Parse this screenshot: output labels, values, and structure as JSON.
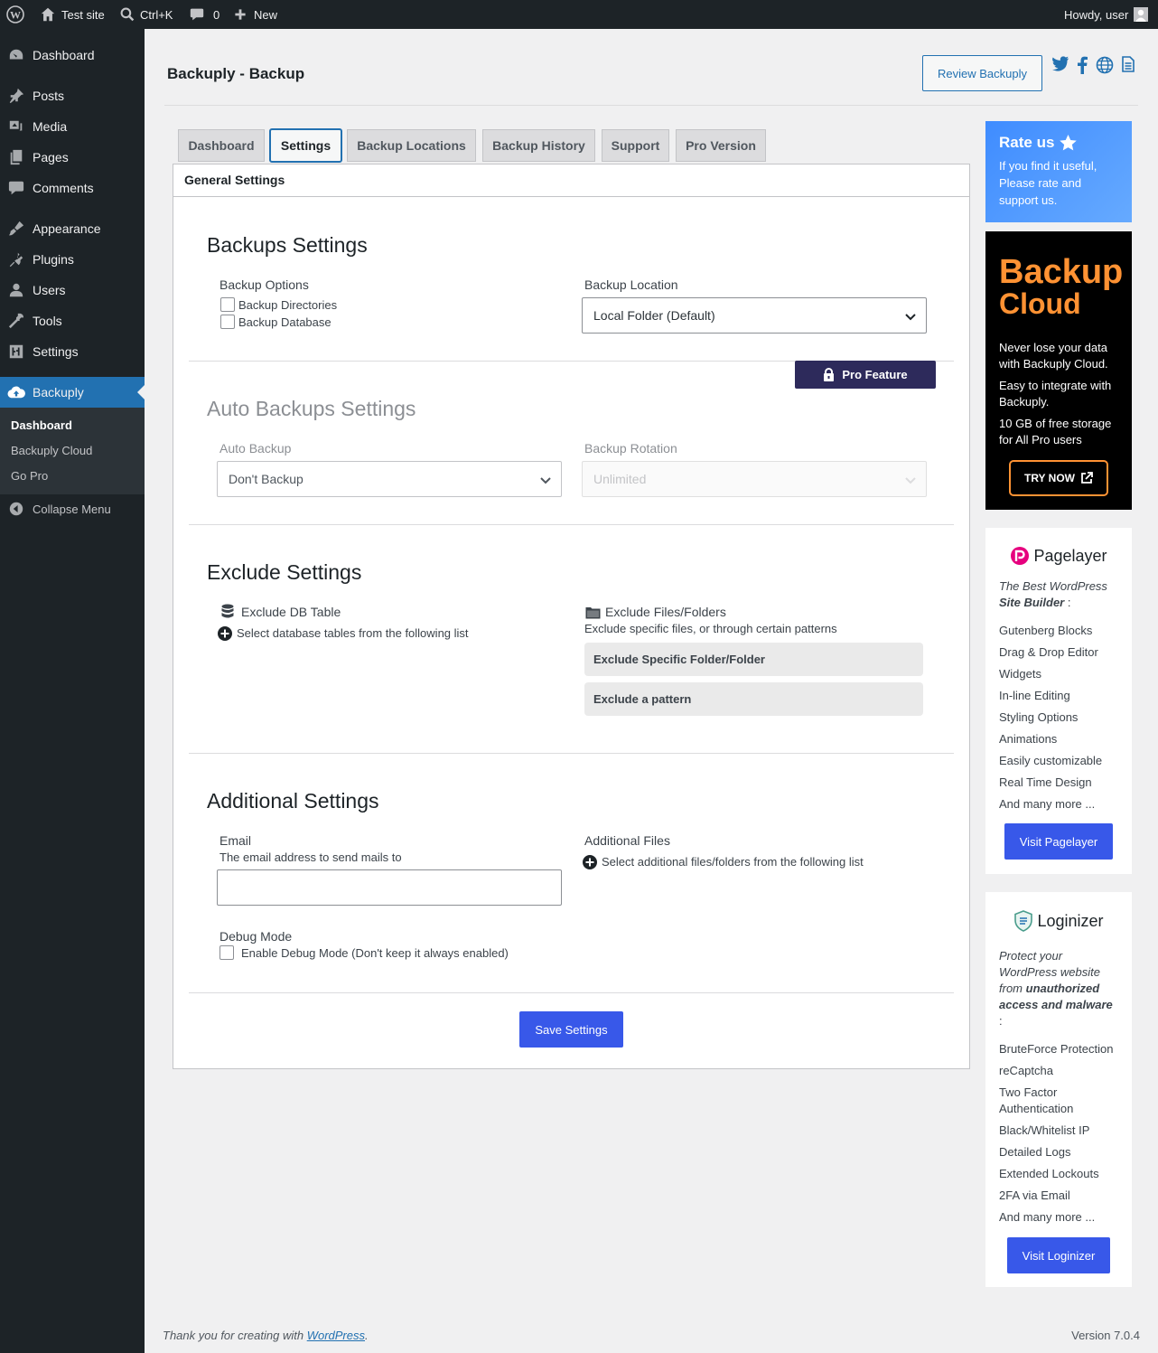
{
  "adminbar": {
    "site_name": "Test site",
    "search_shortcut": "Ctrl+K",
    "comments_count": "0",
    "new_label": "New",
    "howdy": "Howdy, user"
  },
  "sidebar": {
    "items": [
      {
        "label": "Dashboard",
        "icon": "dashboard-icon"
      },
      {
        "label": "Posts",
        "icon": "pin-icon"
      },
      {
        "label": "Media",
        "icon": "media-icon"
      },
      {
        "label": "Pages",
        "icon": "pages-icon"
      },
      {
        "label": "Comments",
        "icon": "comment-icon"
      },
      {
        "label": "Appearance",
        "icon": "brush-icon"
      },
      {
        "label": "Plugins",
        "icon": "plug-icon"
      },
      {
        "label": "Users",
        "icon": "user-icon"
      },
      {
        "label": "Tools",
        "icon": "wrench-icon"
      },
      {
        "label": "Settings",
        "icon": "sliders-icon"
      },
      {
        "label": "Backuply",
        "icon": "cloud-upload-icon"
      }
    ],
    "submenu": [
      "Dashboard",
      "Backuply Cloud",
      "Go Pro"
    ],
    "collapse": "Collapse Menu"
  },
  "header": {
    "title": "Backuply - Backup",
    "review_button": "Review Backuply"
  },
  "tabs": [
    "Dashboard",
    "Settings",
    "Backup Locations",
    "Backup History",
    "Support",
    "Pro Version"
  ],
  "panel": {
    "heading": "General Settings",
    "backups": {
      "title": "Backups Settings",
      "options_label": "Backup Options",
      "opt_dirs": "Backup Directories",
      "opt_db": "Backup Database",
      "location_label": "Backup Location",
      "location_value": "Local Folder (Default)"
    },
    "auto": {
      "pro_badge": "Pro Feature",
      "title": "Auto Backups Settings",
      "auto_label": "Auto Backup",
      "auto_value": "Don't Backup",
      "rotation_label": "Backup Rotation",
      "rotation_value": "Unlimited"
    },
    "exclude": {
      "title": "Exclude Settings",
      "db_label": "Exclude DB Table",
      "db_help": "Select database tables from the following list",
      "files_label": "Exclude Files/Folders",
      "files_help": "Exclude specific files, or through certain patterns",
      "btn_folder": "Exclude Specific Folder/Folder",
      "btn_pattern": "Exclude a pattern"
    },
    "additional": {
      "title": "Additional Settings",
      "email_label": "Email",
      "email_help": "The email address to send mails to",
      "email_value": "",
      "files_label": "Additional Files",
      "files_help": "Select additional files/folders from the following list",
      "debug_label": "Debug Mode",
      "debug_help": "Enable Debug Mode (Don't keep it always enabled)"
    },
    "save": "Save Settings"
  },
  "rate": {
    "title": "Rate us",
    "text": "If you find it useful, Please rate and support us."
  },
  "cloud": {
    "title1": "Backup",
    "title2": "Cloud",
    "text1": "Never lose your data with Backuply Cloud.",
    "text2": "Easy to integrate with Backuply.",
    "text3": "10 GB of free storage for All Pro users",
    "button": "TRY NOW"
  },
  "pagelayer": {
    "name": "Pagelayer",
    "desc_plain": "The Best WordPress",
    "desc_bold": "Site Builder",
    "desc_end": " :",
    "features": [
      "Gutenberg Blocks",
      "Drag & Drop Editor",
      "Widgets",
      "In-line Editing",
      "Styling Options",
      "Animations",
      "Easily customizable",
      "Real Time Design",
      "And many more ..."
    ],
    "button": "Visit Pagelayer"
  },
  "loginizer": {
    "name": "Loginizer",
    "desc_plain": "Protect your WordPress website from",
    "desc_bold": "unauthorized access and malware",
    "desc_end": " :",
    "features": [
      "BruteForce Protection",
      "reCaptcha",
      "Two Factor Authentication",
      "Black/Whitelist IP",
      "Detailed Logs",
      "Extended Lockouts",
      "2FA via Email",
      "And many more ..."
    ],
    "button": "Visit Loginizer"
  },
  "footer": {
    "thanks": "Thank you for creating with ",
    "link": "WordPress",
    "period": ".",
    "version": "Version 7.0.4"
  },
  "colors": {
    "accent": "#3858e9",
    "admin_dark": "#1d2327",
    "wp_blue": "#2271b1",
    "cloud_orange": "#ff9233",
    "pro_badge": "#2d2a5b"
  }
}
